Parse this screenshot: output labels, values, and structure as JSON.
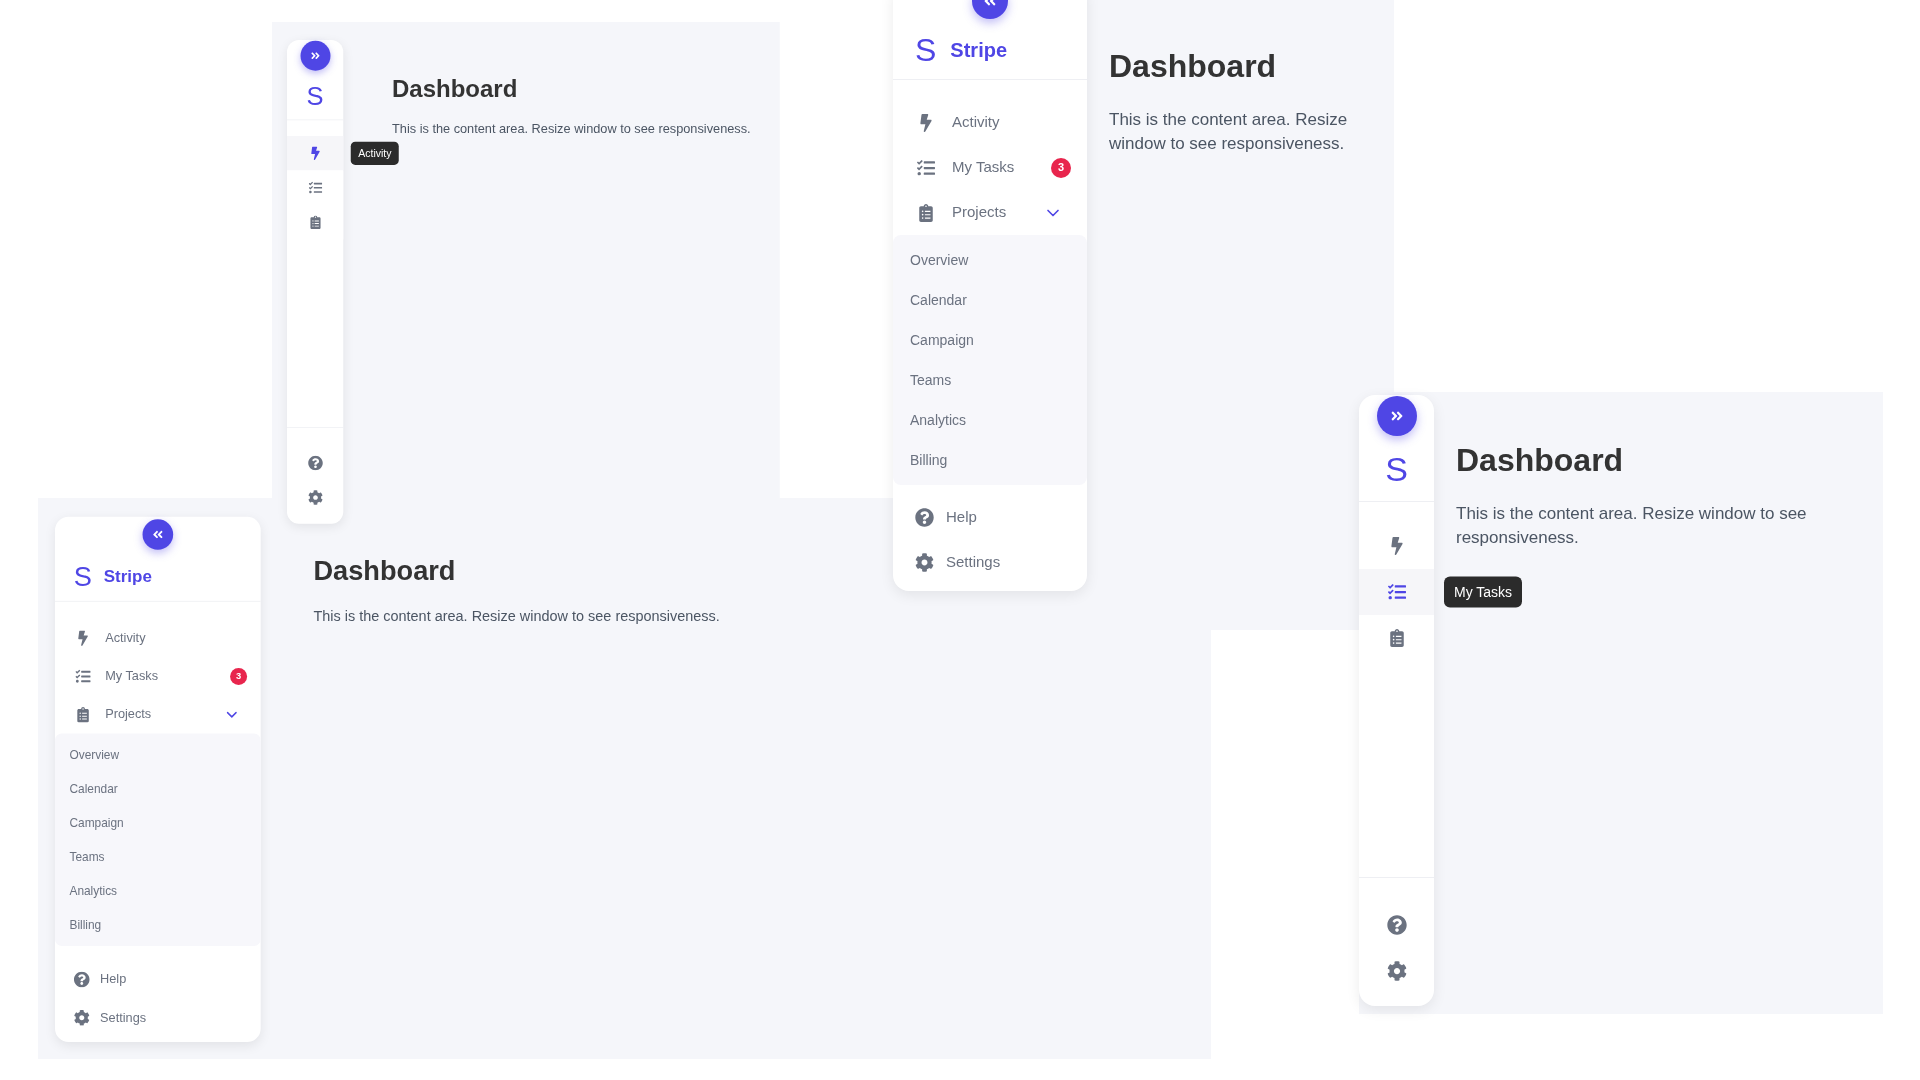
{
  "panels": [
    {
      "kind": "collapsed",
      "logo": "S",
      "nav": [
        {
          "kind": "bolt",
          "selected": true,
          "tooltip": "Activity"
        },
        {
          "kind": "tasks",
          "selected": false
        },
        {
          "kind": "projects",
          "selected": false
        }
      ],
      "footer": [
        {
          "kind": "help"
        },
        {
          "kind": "settings"
        }
      ],
      "content": {
        "title": "Dashboard",
        "text": "This is the content area. Resize window to see responsiveness."
      }
    },
    {
      "kind": "expanded",
      "logo": "S",
      "brand": "Stripe",
      "nav": [
        {
          "kind": "bolt",
          "label": "Activity",
          "selected": false
        },
        {
          "kind": "tasks",
          "label": "My Tasks",
          "badge": "3",
          "selected": false
        },
        {
          "kind": "projects",
          "label": "Projects",
          "selected": false,
          "expanded": true,
          "children": [
            "Overview",
            "Calendar",
            "Campaign",
            "Teams",
            "Analytics",
            "Billing"
          ]
        }
      ],
      "footer": [
        {
          "kind": "help",
          "label": "Help"
        },
        {
          "kind": "settings",
          "label": "Settings"
        }
      ],
      "content": {
        "title": "Dashboard",
        "text": "This is the content area. Resize window to see responsiveness."
      }
    },
    {
      "kind": "expanded",
      "logo": "S",
      "brand": "Stripe",
      "nav": [
        {
          "kind": "bolt",
          "label": "Activity",
          "selected": false
        },
        {
          "kind": "tasks",
          "label": "My Tasks",
          "badge": "3",
          "selected": false
        },
        {
          "kind": "projects",
          "label": "Projects",
          "selected": false,
          "expanded": true,
          "children": [
            "Overview",
            "Calendar",
            "Campaign",
            "Teams",
            "Analytics",
            "Billing"
          ]
        }
      ],
      "footer": [
        {
          "kind": "help",
          "label": "Help"
        },
        {
          "kind": "settings",
          "label": "Settings"
        }
      ],
      "content": {
        "title": "Dashboard",
        "text": "This is the content area. Resize window to see responsiveness."
      }
    },
    {
      "kind": "collapsed",
      "logo": "S",
      "nav": [
        {
          "kind": "bolt",
          "selected": false
        },
        {
          "kind": "tasks",
          "selected": true,
          "tooltip": "My Tasks"
        },
        {
          "kind": "projects",
          "selected": false
        }
      ],
      "footer": [
        {
          "kind": "help"
        },
        {
          "kind": "settings"
        }
      ],
      "content": {
        "title": "Dashboard",
        "text": "This is the content area. Resize window to see responsiveness."
      }
    }
  ]
}
